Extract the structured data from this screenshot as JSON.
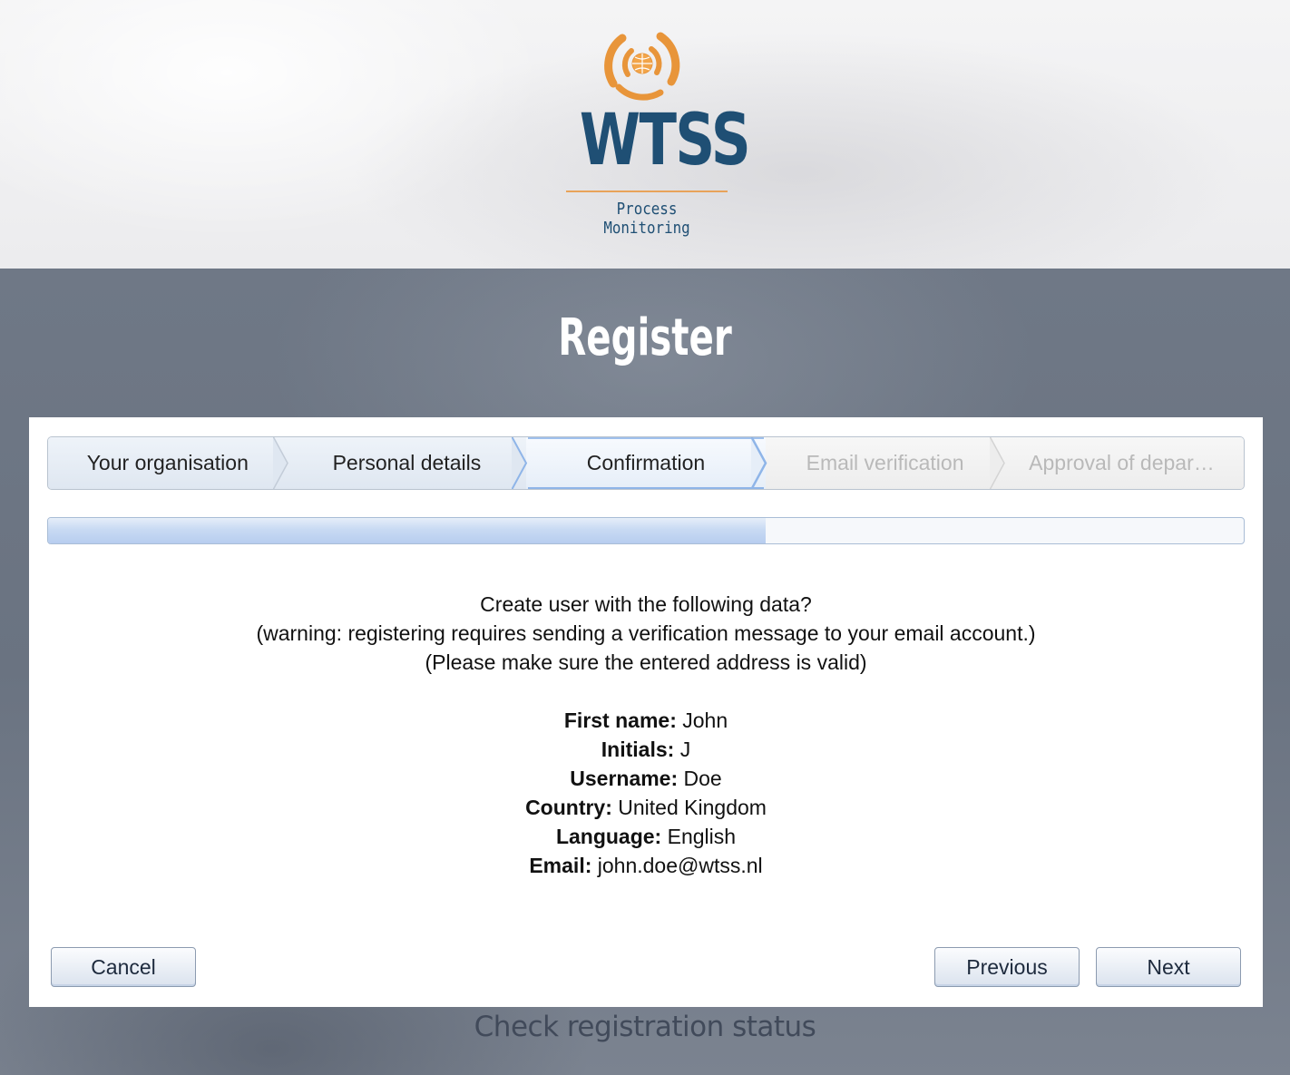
{
  "logo": {
    "name": "WTSS",
    "tagline": "Process Monitoring"
  },
  "page": {
    "title": "Register"
  },
  "wizard": {
    "steps": [
      {
        "label": "Your organisation",
        "state": "done"
      },
      {
        "label": "Personal details",
        "state": "done"
      },
      {
        "label": "Confirmation",
        "state": "active"
      },
      {
        "label": "Email verification",
        "state": "disabled"
      },
      {
        "label": "Approval of department",
        "state": "disabled"
      }
    ],
    "progress_fraction": 0.6
  },
  "confirmation": {
    "question": "Create user with the following data?",
    "warning": "(warning: registering requires sending a verification message to your email account.)",
    "note": "(Please make sure the entered address is valid)",
    "fields": [
      {
        "label": "First name:",
        "value": "John"
      },
      {
        "label": "Initials:",
        "value": "J"
      },
      {
        "label": "Username:",
        "value": "Doe"
      },
      {
        "label": "Country:",
        "value": "United Kingdom"
      },
      {
        "label": "Language:",
        "value": "English"
      },
      {
        "label": "Email:",
        "value": "john.doe@wtss.nl"
      }
    ]
  },
  "buttons": {
    "cancel": "Cancel",
    "previous": "Previous",
    "next": "Next"
  },
  "footer": {
    "status_link": "Check registration status"
  },
  "colors": {
    "logo_blue": "#1f4f74",
    "logo_orange": "#e8953a",
    "active_step_border": "#8fb5e8"
  }
}
